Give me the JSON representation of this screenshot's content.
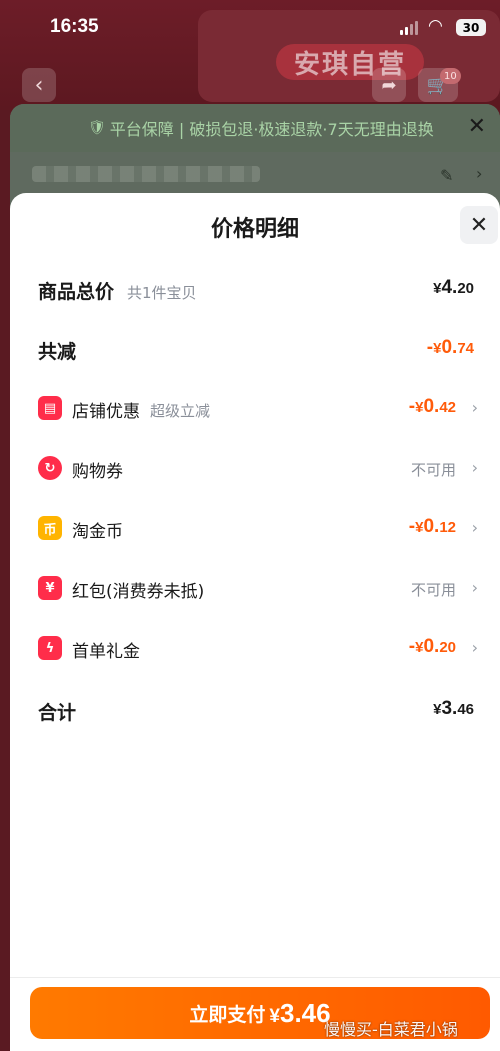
{
  "status_bar": {
    "time": "16:35",
    "battery": "30"
  },
  "background": {
    "brand": "安琪自营",
    "cart_badge": "10",
    "guarantee_text": "平台保障 | 破损包退·极速退款·7天无理由退换"
  },
  "sheet": {
    "title": "价格明细",
    "total_price": {
      "label": "商品总价",
      "sub": "共1件宝贝",
      "yen": "¥",
      "int": "4.",
      "dec": "20"
    },
    "total_discount": {
      "label": "共减",
      "sign": "-",
      "yen": "¥",
      "int": "0.",
      "dec": "74"
    },
    "items": [
      {
        "name": "store-discount",
        "label": "店铺优惠",
        "sub": "超级立减",
        "sign": "-",
        "yen": "¥",
        "int": "0.",
        "dec": "42",
        "icon": "store-icon",
        "icon_color": "#ff2d4a"
      },
      {
        "name": "shopping-voucher",
        "label": "购物券",
        "value": "不可用",
        "icon": "voucher-icon",
        "icon_color": "#ff2d4a"
      },
      {
        "name": "taojinbi",
        "label": "淘金币",
        "sign": "-",
        "yen": "¥",
        "int": "0.",
        "dec": "12",
        "icon": "coin-icon",
        "icon_color": "#ffb400"
      },
      {
        "name": "red-packet",
        "label": "红包(消费券未抵)",
        "value": "不可用",
        "icon": "red-packet-icon",
        "icon_color": "#ff2d4a"
      },
      {
        "name": "first-order-gift",
        "label": "首单礼金",
        "sign": "-",
        "yen": "¥",
        "int": "0.",
        "dec": "20",
        "icon": "gift-icon",
        "icon_color": "#ff2d4a"
      }
    ],
    "sum": {
      "label": "合计",
      "yen": "¥",
      "int": "3.",
      "dec": "46"
    }
  },
  "pay_button": {
    "label": "立即支付",
    "yen": "¥",
    "amount": "3.46"
  },
  "watermark": "慢慢买-白菜君小锅",
  "colors": {
    "accent_orange": "#ff5b0a",
    "button_orange": "#ff6a00",
    "icon_red": "#ff2d4a",
    "icon_yellow": "#ffb400"
  }
}
